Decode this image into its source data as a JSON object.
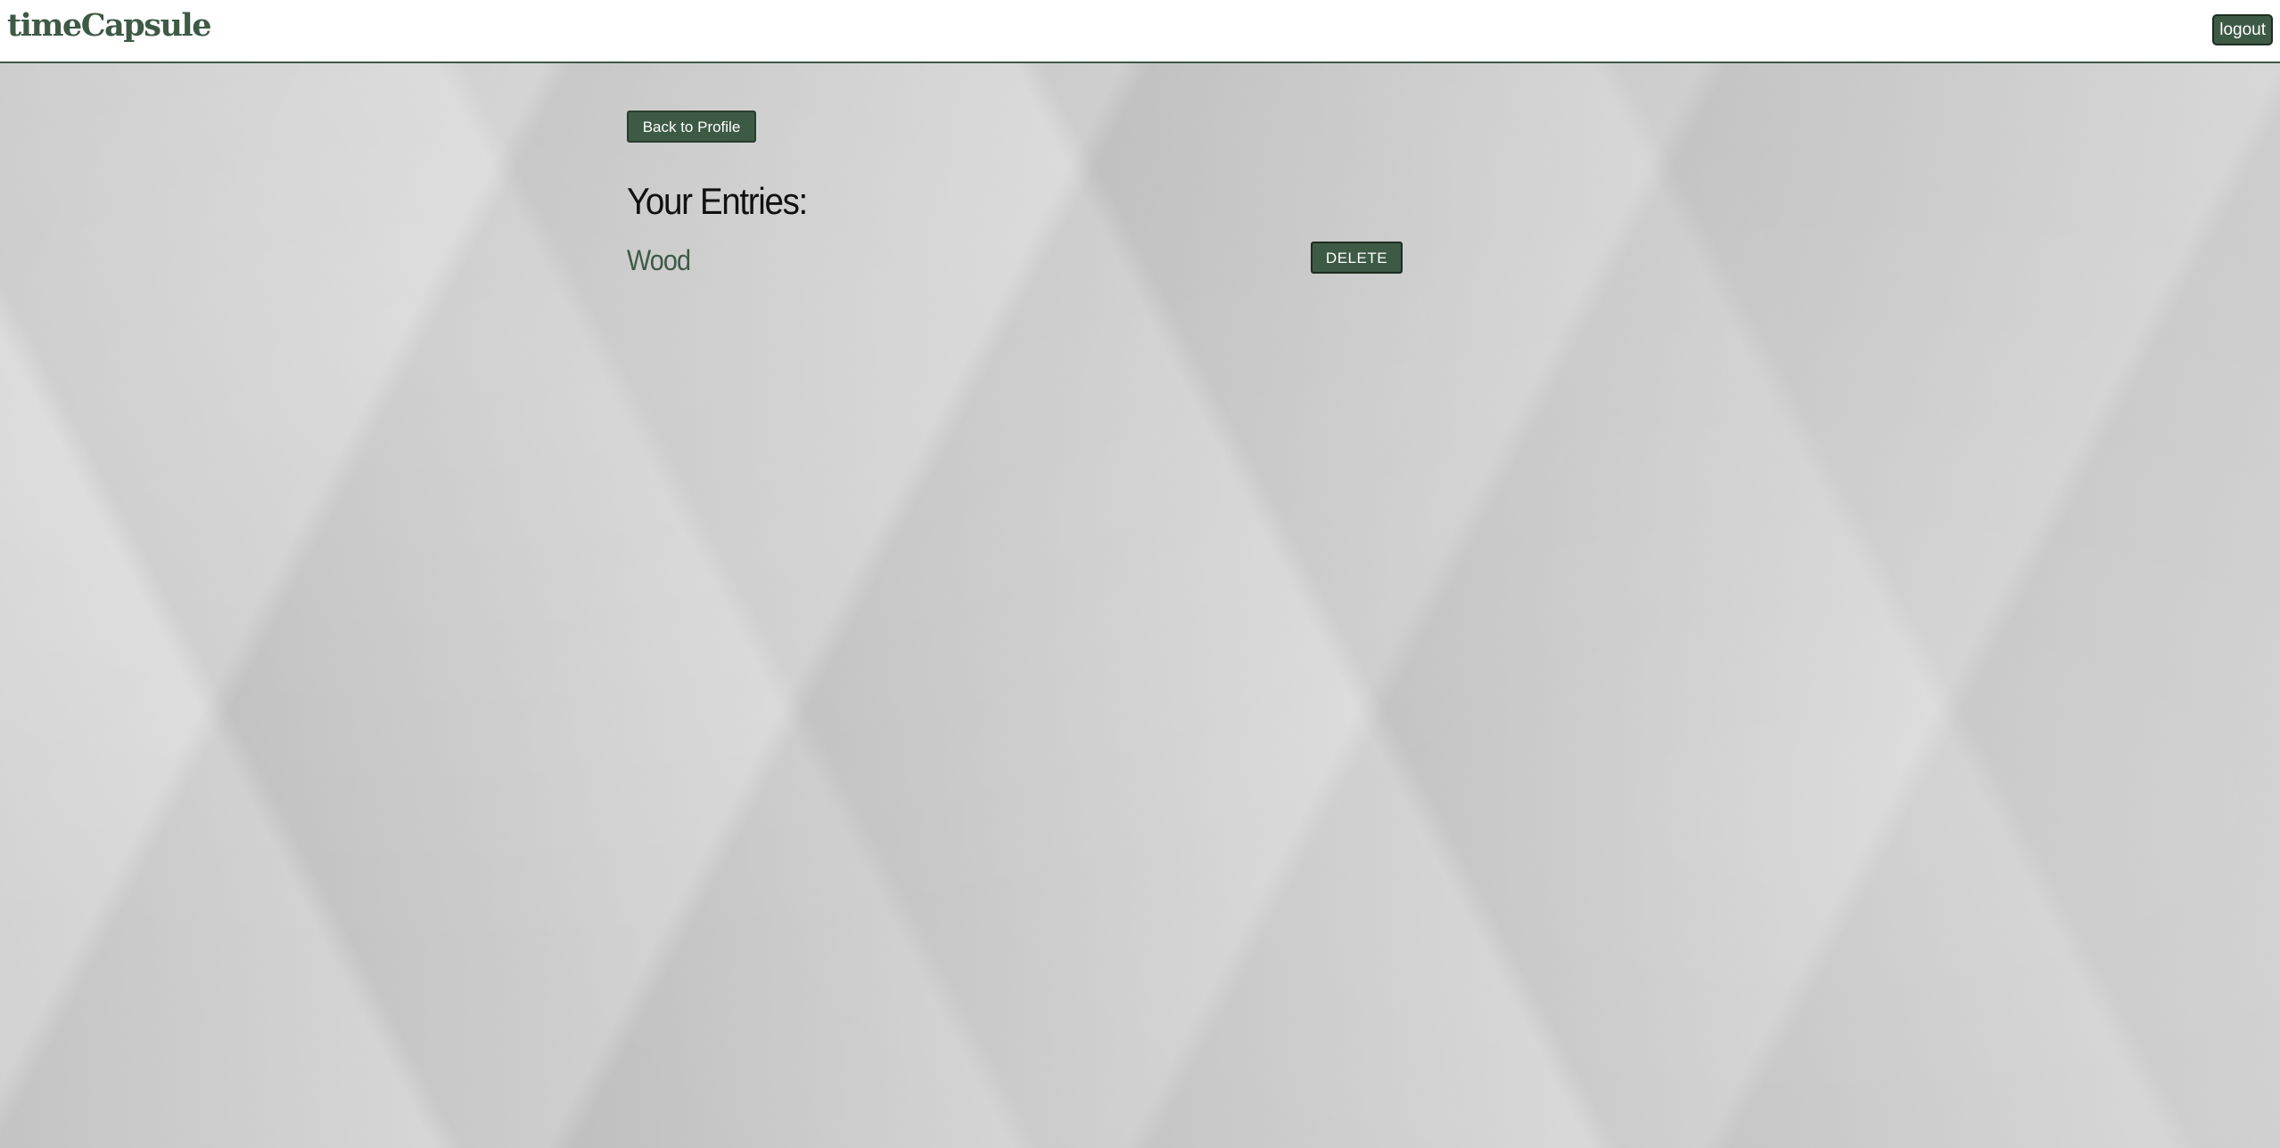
{
  "navbar": {
    "brand": "timeCapsule",
    "logout_label": "logout"
  },
  "main": {
    "back_label": "Back to Profile",
    "heading": "Your Entries:",
    "entries": [
      {
        "title": "Wood",
        "delete_label": "DELETE"
      }
    ]
  },
  "colors": {
    "accent": "#3d5a45",
    "header_bg": "#ffffff",
    "page_bg": "#d2d2d2"
  }
}
